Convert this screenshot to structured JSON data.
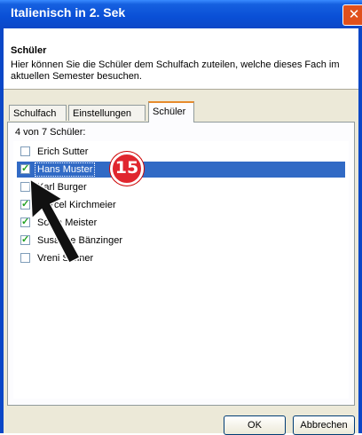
{
  "window": {
    "title": "Italienisch in 2. Sek",
    "close_glyph": "✕"
  },
  "header": {
    "title": "Schüler",
    "description": "Hier können Sie die Schüler dem Schulfach zuteilen, welche dieses Fach im aktuellen Semester besuchen."
  },
  "tabs": [
    {
      "label": "Schulfach",
      "active": false
    },
    {
      "label": "Einstellungen",
      "active": false
    },
    {
      "label": "Schüler",
      "active": true
    }
  ],
  "list": {
    "count_text": "4 von 7 Schüler:",
    "items": [
      {
        "label": "Erich Sutter",
        "checked": false,
        "selected": false
      },
      {
        "label": "Hans Muster",
        "checked": true,
        "selected": true
      },
      {
        "label": "Karl Burger",
        "checked": false,
        "selected": false
      },
      {
        "label": "Marcel Kirchmeier",
        "checked": true,
        "selected": false
      },
      {
        "label": "Sonja Meister",
        "checked": true,
        "selected": false
      },
      {
        "label": "Susanne Bänzinger",
        "checked": true,
        "selected": false
      },
      {
        "label": "Vreni Steiner",
        "checked": false,
        "selected": false
      }
    ]
  },
  "buttons": {
    "ok": "OK",
    "cancel": "Abbrechen"
  },
  "annotation": {
    "step": "15"
  },
  "colors": {
    "selection": "#316ac5",
    "titlebar": "#0a4fd6",
    "tab_accent": "#e68b2c",
    "badge": "#e0262e"
  }
}
